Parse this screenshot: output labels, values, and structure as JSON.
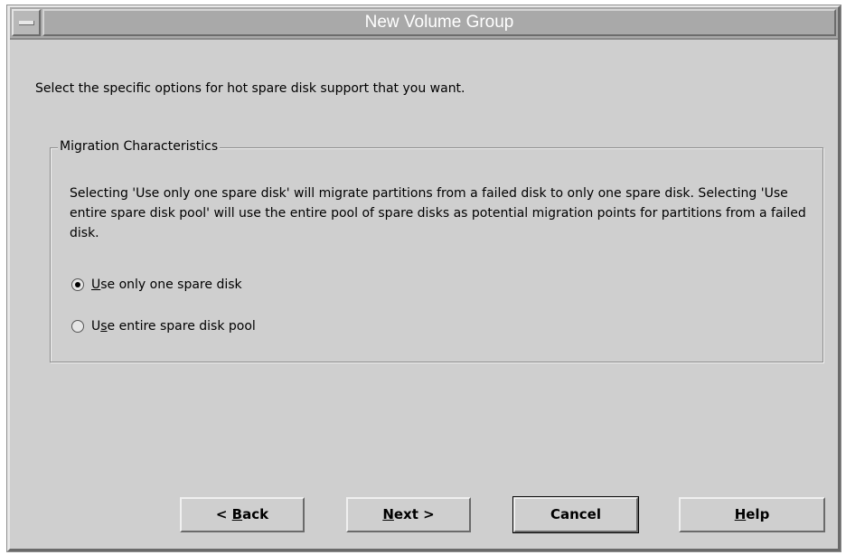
{
  "window": {
    "title": "New Volume Group"
  },
  "instruction": "Select the specific options for hot spare disk support that you want.",
  "group": {
    "label": "Migration Characteristics",
    "description": "Selecting 'Use only one spare disk' will migrate partitions from a failed disk to only one spare disk. Selecting 'Use entire spare disk pool' will use the entire pool of spare disks as potential migration points for partitions from a failed disk.",
    "options": [
      {
        "pre": "",
        "mnemonic": "U",
        "post": "se only one spare disk",
        "selected": true
      },
      {
        "pre": "U",
        "mnemonic": "s",
        "post": "e entire spare disk pool",
        "selected": false
      }
    ]
  },
  "buttons": {
    "back": {
      "pre": "< ",
      "mnemonic": "B",
      "post": "ack"
    },
    "next": {
      "pre": "",
      "mnemonic": "N",
      "post": "ext >"
    },
    "cancel": {
      "pre": "",
      "mnemonic": "",
      "post": "Cancel"
    },
    "help": {
      "pre": "",
      "mnemonic": "H",
      "post": "elp"
    }
  },
  "icons": {
    "system_menu": "window-menu-icon",
    "radio_on": "radio-selected-icon",
    "radio_off": "radio-unselected-icon"
  }
}
